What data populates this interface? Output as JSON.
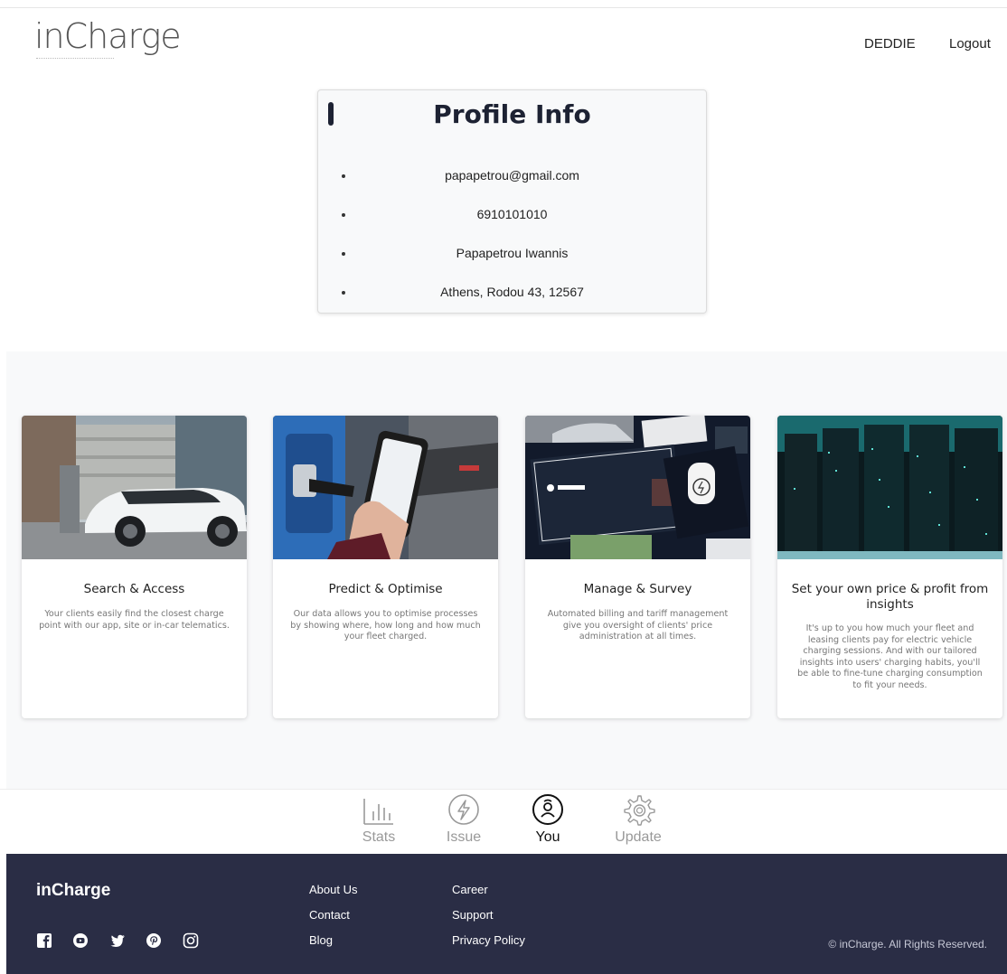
{
  "header": {
    "logo": "inCharge",
    "user": "DEDDIE",
    "logout": "Logout"
  },
  "profile": {
    "title": "Profile Info",
    "items": [
      "papapetrou@gmail.com",
      "6910101010",
      "Papapetrou Iwannis",
      "Athens, Rodou 43, 12567"
    ]
  },
  "features": [
    {
      "title": "Search & Access",
      "description": "Your clients easily find the closest charge point with our app, site or in-car telematics."
    },
    {
      "title": "Predict & Optimise",
      "description": "Our data allows you to optimise processes by showing where, how long and how much your fleet charged."
    },
    {
      "title": "Manage & Survey",
      "description": "Automated billing and tariff management give you oversight of clients' price administration at all times."
    },
    {
      "title": "Set your own price & profit from insights",
      "description": "It's up to you how much your fleet and leasing clients pay for electric vehicle charging sessions. And with our tailored insights into users' charging habits, you'll be able to fine-tune charging consumption to fit your needs."
    }
  ],
  "tabs": {
    "stats": "Stats",
    "issue": "Issue",
    "you": "You",
    "update": "Update",
    "active": "You"
  },
  "footer": {
    "brand": "inCharge",
    "links_col1": [
      "About Us",
      "Contact",
      "Blog"
    ],
    "links_col2": [
      "Career",
      "Support",
      "Privacy Policy"
    ],
    "copyright": "© inCharge. All Rights Reserved.",
    "social_icons": [
      "facebook-icon",
      "youtube-icon",
      "twitter-icon",
      "pinterest-icon",
      "instagram-icon"
    ]
  }
}
